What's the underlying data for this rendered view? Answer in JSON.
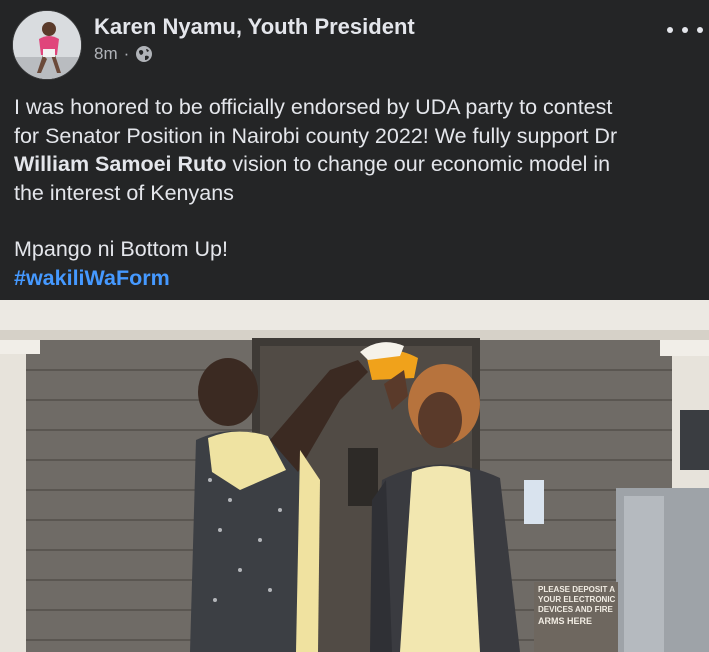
{
  "post": {
    "author": "Karen Nyamu, Youth President",
    "time": "8m",
    "separator": "·",
    "audience_icon": "globe-icon",
    "menu_icon": "more-options-icon",
    "text": {
      "line1": "I was honored to be officially endorsed by UDA party to contest",
      "line2": "for Senator Position in Nairobi county 2022! We fully support Dr",
      "line3_bold": "William Samoei Ruto",
      "line3_rest": " vision to change our economic model in",
      "line4": "the interest of Kenyans",
      "line5": "Mpango ni Bottom Up!",
      "hashtag": "#wakiliWaForm"
    },
    "photo": {
      "sign_text": "PLEASE DEPOSIT A YOUR ELECTRONIC DEVICES AND FIRE ARMS HERE"
    }
  },
  "colors": {
    "background": "#242526",
    "text": "#e4e6eb",
    "secondary_text": "#b0b3b8",
    "hashtag": "#4599ff"
  }
}
